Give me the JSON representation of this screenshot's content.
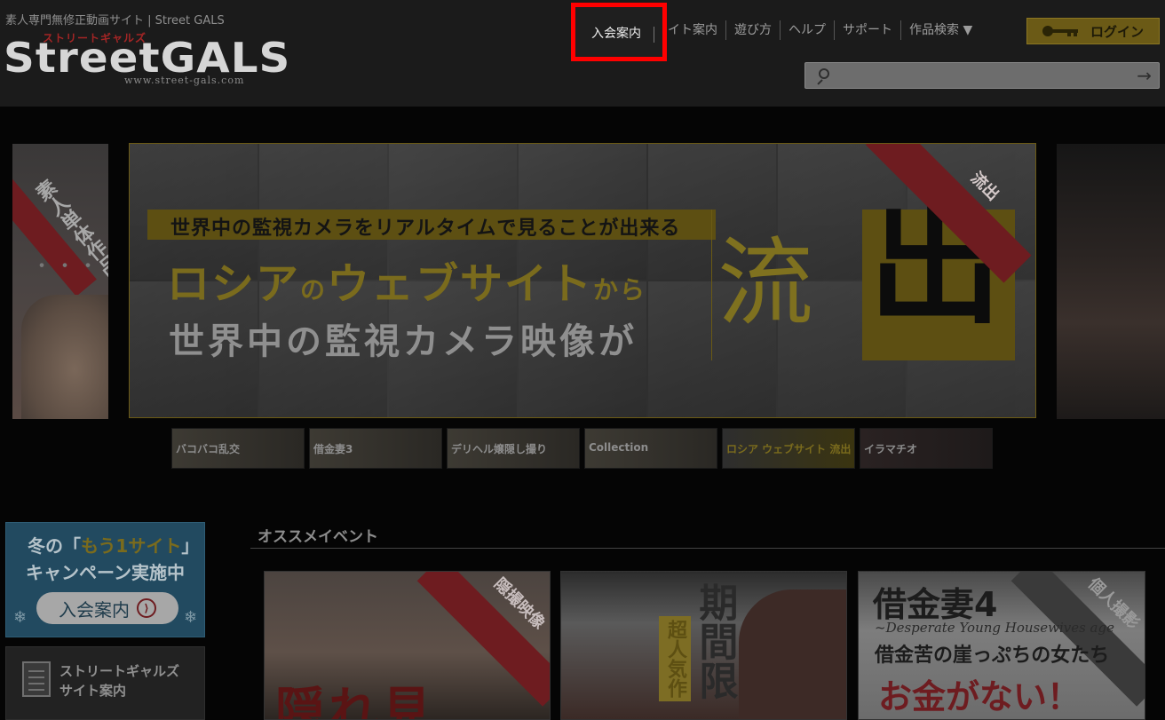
{
  "header": {
    "tagline": "素人専門無修正動画サイト | Street GALS",
    "logo_main": "StreetGALS",
    "logo_kana": "ストリートギャルズ",
    "logo_url": "www.street-gals.com"
  },
  "nav": {
    "items": [
      {
        "label": "入会案内"
      },
      {
        "label": "サイト案内"
      },
      {
        "label": "遊び方"
      },
      {
        "label": "ヘルプ"
      },
      {
        "label": "サポート"
      },
      {
        "label": "作品検索 ▼"
      }
    ],
    "login_label": "ログイン"
  },
  "search": {
    "value": "",
    "placeholder": ""
  },
  "side_left": {
    "ribbon_text": "素人単体作品",
    "dots": "・・・"
  },
  "banner": {
    "strap": "世界中の監視カメラをリアルタイムで見ることが出来る",
    "line2_a": "ロシア",
    "line2_b": "の",
    "line2_c": "ウェブサイト",
    "line2_d": "から",
    "line3": "世界中の監視カメラ映像が",
    "ryu": "流",
    "shutsu": "出",
    "corner": "流出"
  },
  "thumbnails": [
    {
      "text": "バコバコ乱交"
    },
    {
      "text": "借金妻3"
    },
    {
      "text": "デリヘル嬢隠し撮り"
    },
    {
      "text": "Collection"
    },
    {
      "text": "ロシア ウェブサイト 流出"
    },
    {
      "text": "イラマチオ"
    }
  ],
  "campaign": {
    "line1_prefix": "冬の「",
    "line1_highlight": "もう1サイト",
    "line1_suffix": "」",
    "line2": "キャンペーン実施中",
    "button_label": "入会案内",
    "go_symbol": "⟩"
  },
  "guide": {
    "line1": "ストリートギャルズ",
    "line2": "サイト案内"
  },
  "section": {
    "title": "オススメイベント"
  },
  "cards": [
    {
      "ribbon": "隠撮映像",
      "title": "隠れ見"
    },
    {
      "vertical_title": "期間限",
      "vertical_sub": "超人気作"
    },
    {
      "ribbon": "個人撮影",
      "title": "借金妻4",
      "subtitle": "~Desperate Young Housewives age",
      "line3": "借金苦の崖っぷちの女たち",
      "line4": "お金がない！"
    }
  ]
}
